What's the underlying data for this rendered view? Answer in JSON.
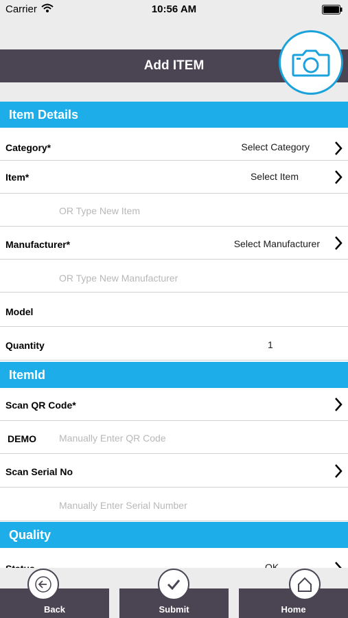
{
  "status_bar": {
    "carrier": "Carrier",
    "time": "10:56 AM"
  },
  "header": {
    "title": "Add ITEM",
    "camera_icon": "camera-icon"
  },
  "sections": {
    "item_details": "Item Details",
    "itemid": "ItemId",
    "quality": "Quality"
  },
  "item_details": {
    "category": {
      "label": "Category*",
      "value": "Select Category"
    },
    "item": {
      "label": "Item*",
      "value": "Select Item"
    },
    "new_item_placeholder": "OR Type New Item",
    "manufacturer": {
      "label": "Manufacturer*",
      "value": "Select Manufacturer"
    },
    "new_manufacturer_placeholder": "OR Type New Manufacturer",
    "model": {
      "label": "Model",
      "value": ""
    },
    "quantity": {
      "label": "Quantity",
      "value": "1"
    }
  },
  "itemid": {
    "scan_qr": {
      "label": "Scan QR Code*"
    },
    "manual_qr": {
      "label": "DEMO",
      "placeholder": "Manually Enter QR Code"
    },
    "scan_serial": {
      "label": "Scan Serial No"
    },
    "manual_serial": {
      "placeholder": "Manually Enter Serial Number"
    }
  },
  "quality": {
    "status": {
      "label": "Status",
      "value": "OK"
    }
  },
  "bottom_nav": [
    {
      "label": "Back",
      "icon": "back-arrow-icon"
    },
    {
      "label": "Submit",
      "icon": "checkmark-icon"
    },
    {
      "label": "Home",
      "icon": "home-icon"
    }
  ],
  "colors": {
    "accent": "#1daee9",
    "header": "#4a4453",
    "background": "#ececec"
  }
}
